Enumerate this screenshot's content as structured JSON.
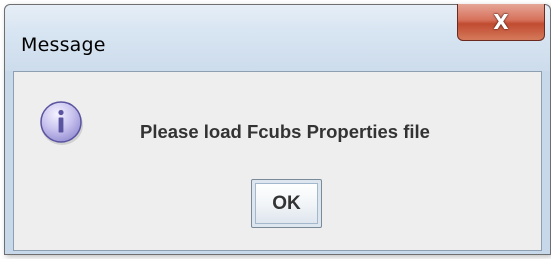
{
  "dialog": {
    "title": "Message",
    "close_label": "X",
    "message": "Please load Fcubs Properties file",
    "ok_label": "OK",
    "icon": "info-icon"
  }
}
